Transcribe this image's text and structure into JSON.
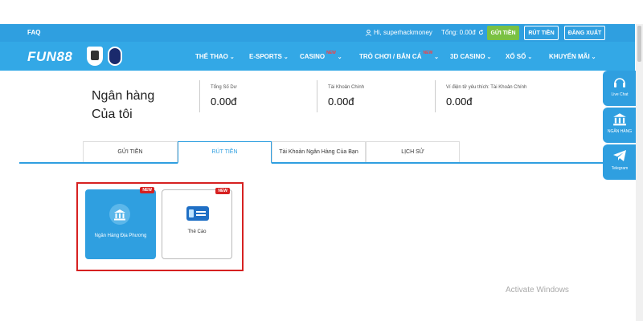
{
  "top_bar": {
    "faq": "FAQ",
    "greeting": "Hi, superhackmoney",
    "balance_label": "Tổng: 0.00đ",
    "deposit_label": "GỬI TIỀN",
    "withdraw_label": "RÚT TIỀN",
    "logout_label": "ĐĂNG XUẤT"
  },
  "nav": {
    "logo": "FUN88",
    "new_badge": "NEW",
    "items": [
      {
        "label": "THỂ THAO"
      },
      {
        "label": "E-SPORTS"
      },
      {
        "label": "CASINO"
      },
      {
        "label": "TRÒ CHƠI / BẮN CÁ"
      },
      {
        "label": "3D CASINO"
      },
      {
        "label": "XỔ SỐ"
      },
      {
        "label": "KHUYẾN MÃI"
      }
    ]
  },
  "page": {
    "title_line1": "Ngân hàng",
    "title_line2": "Của tôi"
  },
  "summary": [
    {
      "label": "Tổng Số Dư",
      "value": "0.00đ"
    },
    {
      "label": "Tài Khoản Chính",
      "value": "0.00đ"
    },
    {
      "label": "Ví điện tử yêu thích: Tài Khoản Chính",
      "value": "0.00đ"
    }
  ],
  "tabs": [
    {
      "label": "GỬI TIỀN"
    },
    {
      "label": "RÚT TIỀN"
    },
    {
      "label": "Tài Khoản Ngân Hàng Của Bạn"
    },
    {
      "label": "LỊCH SỬ"
    }
  ],
  "methods": [
    {
      "label": "Ngân Hàng Địa Phương",
      "badge": "NEW"
    },
    {
      "label": "Thẻ Cào",
      "badge": "NEW"
    }
  ],
  "side_panel": [
    {
      "label": "Live Chat"
    },
    {
      "label": "NGÂN HÀNG"
    },
    {
      "label": "Telegram"
    }
  ],
  "watermark": "Activate Windows",
  "colors": {
    "primary": "#2f9fe0",
    "accent_green": "#7ac143",
    "highlight_red": "#d62121"
  }
}
